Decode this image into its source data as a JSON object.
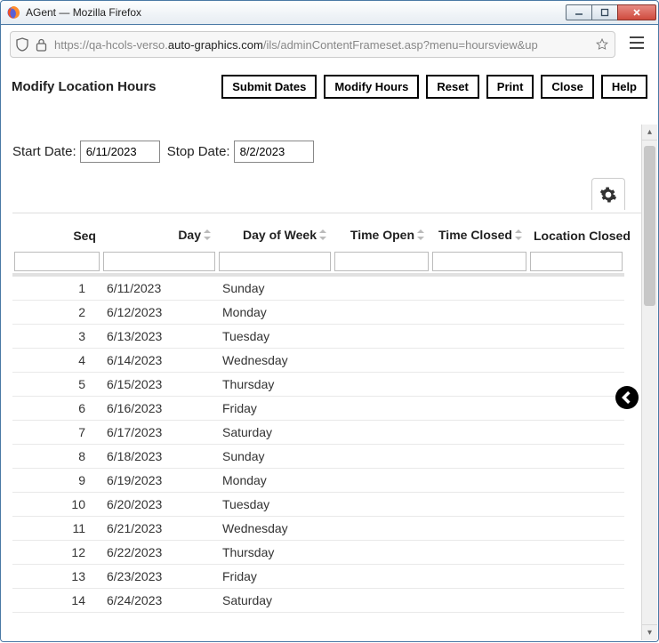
{
  "window": {
    "title": "AGent — Mozilla Firefox"
  },
  "url": {
    "prefix": "https://qa-hcols-verso.",
    "host": "auto-graphics.com",
    "path": "/ils/adminContentFrameset.asp?menu=hoursview&up"
  },
  "header": {
    "title": "Modify Location Hours",
    "buttons": {
      "submit": "Submit Dates",
      "modify": "Modify Hours",
      "reset": "Reset",
      "print": "Print",
      "close": "Close",
      "help": "Help"
    }
  },
  "dates": {
    "start_label": "Start Date:",
    "start_value": "6/11/2023",
    "stop_label": "Stop Date:",
    "stop_value": "8/2/2023"
  },
  "columns": {
    "seq": "Seq",
    "day": "Day",
    "dow": "Day of Week",
    "open": "Time Open",
    "closed": "Time Closed",
    "loc": "Location Closed"
  },
  "rows": [
    {
      "seq": "1",
      "day": "6/11/2023",
      "dow": "Sunday"
    },
    {
      "seq": "2",
      "day": "6/12/2023",
      "dow": "Monday"
    },
    {
      "seq": "3",
      "day": "6/13/2023",
      "dow": "Tuesday"
    },
    {
      "seq": "4",
      "day": "6/14/2023",
      "dow": "Wednesday"
    },
    {
      "seq": "5",
      "day": "6/15/2023",
      "dow": "Thursday"
    },
    {
      "seq": "6",
      "day": "6/16/2023",
      "dow": "Friday"
    },
    {
      "seq": "7",
      "day": "6/17/2023",
      "dow": "Saturday"
    },
    {
      "seq": "8",
      "day": "6/18/2023",
      "dow": "Sunday"
    },
    {
      "seq": "9",
      "day": "6/19/2023",
      "dow": "Monday"
    },
    {
      "seq": "10",
      "day": "6/20/2023",
      "dow": "Tuesday"
    },
    {
      "seq": "11",
      "day": "6/21/2023",
      "dow": "Wednesday"
    },
    {
      "seq": "12",
      "day": "6/22/2023",
      "dow": "Thursday"
    },
    {
      "seq": "13",
      "day": "6/23/2023",
      "dow": "Friday"
    },
    {
      "seq": "14",
      "day": "6/24/2023",
      "dow": "Saturday"
    }
  ]
}
